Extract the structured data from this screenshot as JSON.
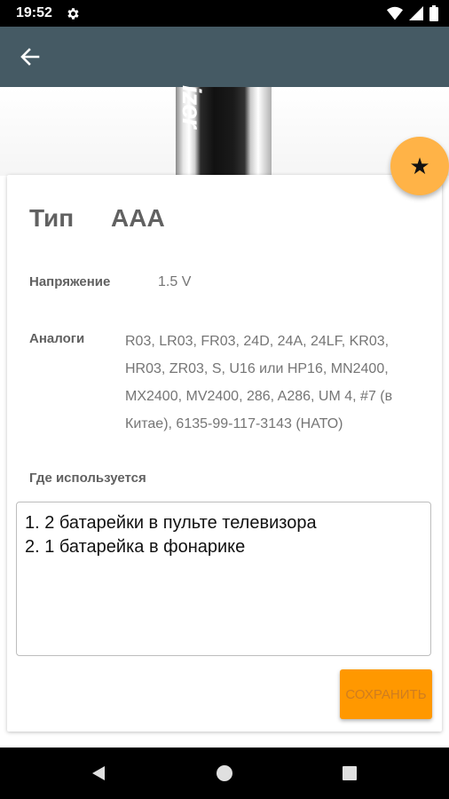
{
  "status_bar": {
    "time": "19:52",
    "icons": [
      "gear-icon",
      "wifi-icon",
      "signal-icon",
      "battery-icon"
    ]
  },
  "app_bar": {
    "back_icon": "arrow-left-icon",
    "color": "#455a64"
  },
  "header_image": {
    "brand_text": "izer"
  },
  "fab": {
    "icon": "star-icon",
    "glyph": "★",
    "color": "#ffb347"
  },
  "card": {
    "type_label": "Тип",
    "type_value": "AAA",
    "voltage_label": "Напряжение",
    "voltage_value": "1.5 V",
    "analogs_label": "Аналоги",
    "analogs_value": "R03, LR03, FR03, 24D, 24A, 24LF, KR03, HR03, ZR03, S, U16 или HP16, MN2400, MX2400, MV2400, 286, A286, UM 4, #7 (в Китае), 6135-99-117-3143 (НАТО)",
    "usage_label": "Где используется",
    "usage_lines": [
      "1. 2 батарейки в пульте телевизора",
      "2. 1 батарейка в фонарике"
    ],
    "save_label": "СОХРАНИТЬ",
    "accent": "#ff9800"
  },
  "nav_bar": {
    "icons": [
      "back-triangle-icon",
      "home-circle-icon",
      "recents-square-icon"
    ]
  }
}
